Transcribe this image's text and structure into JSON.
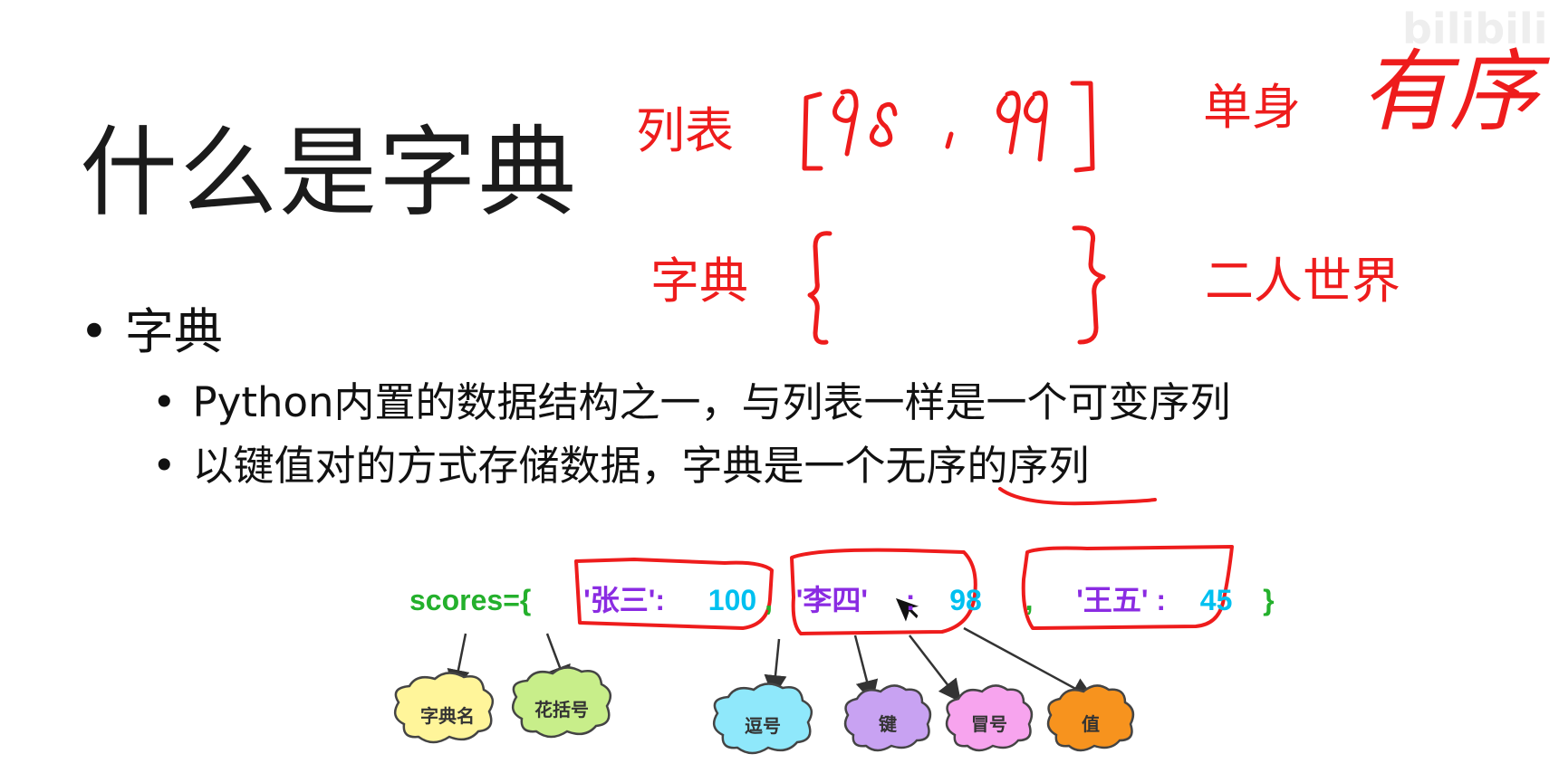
{
  "slide": {
    "title": "什么是字典",
    "bullet_level1": "字典",
    "bullet_level2": [
      "Python内置的数据结构之一，与列表一样是一个可变序列",
      "以键值对的方式存储数据，字典是一个无序的序列"
    ],
    "bullet_mark": "•"
  },
  "annotations": {
    "list_label": "列表",
    "list_example": "[98 , 99]",
    "single_label": "单身",
    "ordered_label": "有序",
    "dict_label": "字典",
    "couple_label": "二人世界",
    "color": "#ee1c1c"
  },
  "code_example": {
    "parts": [
      {
        "text": "scores={",
        "color": "green"
      },
      {
        "text": "'张三':  100",
        "color": "mixed1"
      },
      {
        "text": ",",
        "color": "green"
      },
      {
        "text": "'李四'",
        "color": "purple"
      },
      {
        "text": ":",
        "color": "purple"
      },
      {
        "text": "98",
        "color": "cyan"
      },
      {
        "text": ",",
        "color": "green"
      },
      {
        "text": "'王五' :",
        "color": "purple"
      },
      {
        "text": "45",
        "color": "cyan"
      },
      {
        "text": "}",
        "color": "green"
      }
    ],
    "name": "scores={",
    "k1": "'张三':",
    "v1": "100",
    "comma": ",",
    "k2": "'李四'",
    "colon": ":",
    "v2": "98",
    "k3": "'王五' :",
    "v3": "45",
    "close": "}"
  },
  "clouds": [
    {
      "label": "字典名",
      "color": "#fff59a"
    },
    {
      "label": "花括号",
      "color": "#c8ee8a"
    },
    {
      "label": "逗号",
      "color": "#8fe8fb"
    },
    {
      "label": "键",
      "color": "#c8a2f2"
    },
    {
      "label": "冒号",
      "color": "#f7a4ee"
    },
    {
      "label": "值",
      "color": "#f7931e"
    }
  ],
  "watermark": "bilibili"
}
